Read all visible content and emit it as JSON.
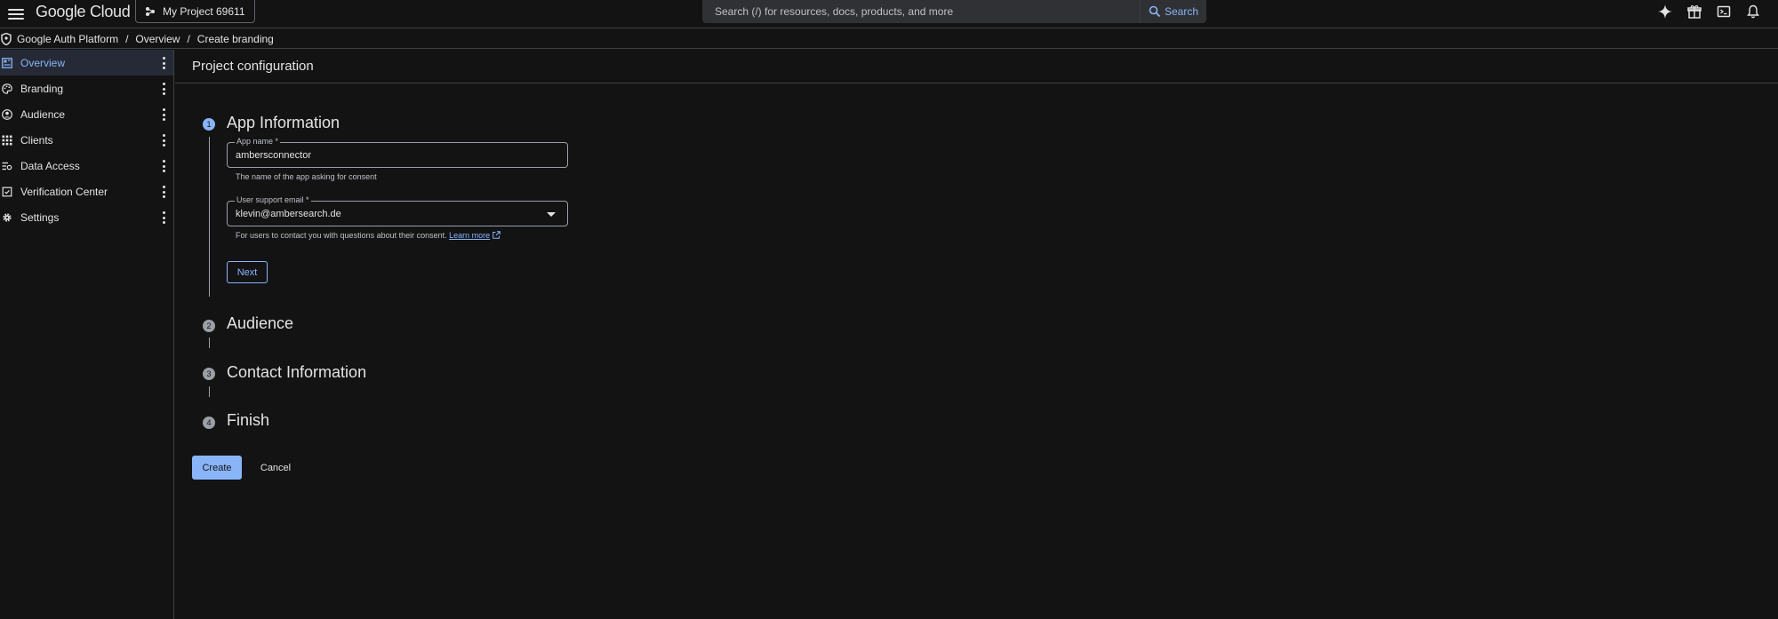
{
  "topbar": {
    "brand": "Google Cloud",
    "project": "My Project 69611",
    "search_placeholder": "Search (/) for resources, docs, products, and more",
    "search_button": "Search",
    "icons": [
      "gemini-sparkle-icon",
      "gift-icon",
      "cloud-shell-icon",
      "notifications-bell-icon"
    ]
  },
  "breadcrumb": {
    "items": [
      "Google Auth Platform",
      "Overview",
      "Create branding"
    ],
    "separator": "/"
  },
  "sidebar": {
    "items": [
      {
        "label": "Overview",
        "icon": "dashboard-icon",
        "active": true
      },
      {
        "label": "Branding",
        "icon": "palette-icon",
        "active": false
      },
      {
        "label": "Audience",
        "icon": "person-icon",
        "active": false
      },
      {
        "label": "Clients",
        "icon": "apps-grid-icon",
        "active": false
      },
      {
        "label": "Data Access",
        "icon": "data-access-icon",
        "active": false
      },
      {
        "label": "Verification Center",
        "icon": "verification-icon",
        "active": false
      },
      {
        "label": "Settings",
        "icon": "gear-icon",
        "active": false
      }
    ]
  },
  "main": {
    "title": "Project configuration",
    "steps": [
      {
        "number": "1",
        "title": "App Information"
      },
      {
        "number": "2",
        "title": "Audience"
      },
      {
        "number": "3",
        "title": "Contact Information"
      },
      {
        "number": "4",
        "title": "Finish"
      }
    ],
    "app_name": {
      "label": "App name *",
      "value": "ambersconnector",
      "hint": "The name of the app asking for consent"
    },
    "support_email": {
      "label": "User support email *",
      "value": "klevin@ambersearch.de",
      "hint": "For users to contact you with questions about their consent.",
      "link": "Learn more"
    },
    "next_button": "Next",
    "create_button": "Create",
    "cancel_button": "Cancel"
  },
  "colors": {
    "background": "#131314",
    "accent": "#8ab4f8",
    "active_nav_bg": "#252a36",
    "border": "#3c4043"
  }
}
